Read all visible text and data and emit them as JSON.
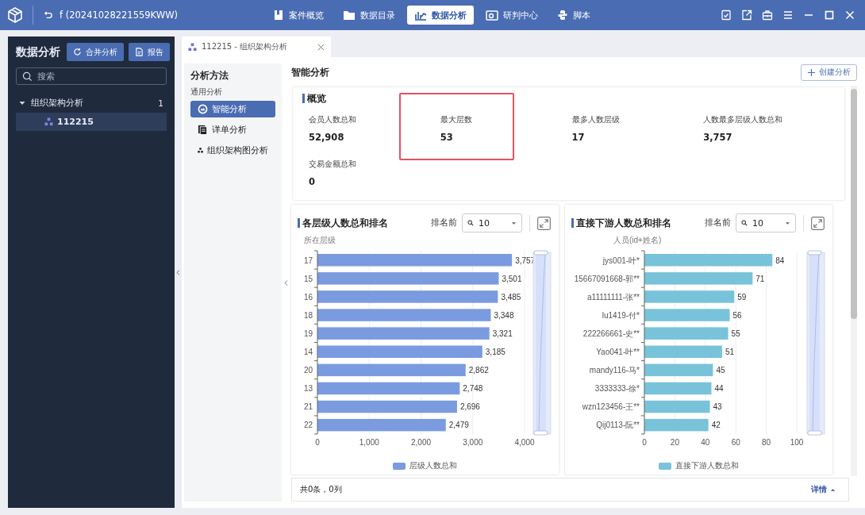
{
  "title_bar": {
    "title": "f (20241028221559KWW)",
    "nav": [
      {
        "label": "案件概览",
        "selected": false
      },
      {
        "label": "数据目录",
        "selected": false
      },
      {
        "label": "数据分析",
        "selected": true
      },
      {
        "label": "研判中心",
        "selected": false
      },
      {
        "label": "脚本",
        "selected": false
      }
    ]
  },
  "sidebar": {
    "title": "数据分析",
    "buttons": [
      "合并分析",
      "报告"
    ],
    "search": {
      "placeholder": "搜索"
    },
    "tree": [
      {
        "label": "组织架构分析",
        "count": "1",
        "expanded": true,
        "selected": false,
        "children": [
          {
            "label": "112215",
            "selected": true
          }
        ]
      }
    ]
  },
  "tab": {
    "label": "112215 - 组织架构分析"
  },
  "methods": {
    "title": "分析方法",
    "group": "通用分析",
    "items": [
      {
        "label": "智能分析",
        "selected": true
      },
      {
        "label": "详单分析",
        "selected": false
      },
      {
        "label": "组织架构图分析",
        "selected": false
      }
    ]
  },
  "content": {
    "title": "智能分析",
    "create_button": "创建分析",
    "overview": {
      "title": "概览",
      "stats": [
        {
          "label": "会员人数总和",
          "value": "52,908",
          "highlighted": false
        },
        {
          "label": "最大层数",
          "value": "53",
          "highlighted": true
        },
        {
          "label": "最多人数层级",
          "value": "17",
          "highlighted": false
        },
        {
          "label": "人数最多层级人数总和",
          "value": "3,757",
          "highlighted": false
        },
        {
          "label": "交易金额总和",
          "value": "0",
          "highlighted": false
        }
      ]
    },
    "charts": [
      {
        "title": "各层级人数总和排名",
        "rank_label": "排名前",
        "rank_value": "10",
        "chart_data": {
          "type": "bar",
          "orientation": "horizontal",
          "ylabel": "所在层级",
          "categories": [
            "17",
            "15",
            "16",
            "18",
            "19",
            "14",
            "20",
            "13",
            "21",
            "22"
          ],
          "series": [
            {
              "name": "层级人数总和",
              "color": "#7b9be0",
              "values": [
                3757,
                3501,
                3485,
                3348,
                3321,
                3185,
                2862,
                2748,
                2696,
                2479
              ]
            }
          ],
          "xlim": [
            0,
            4000
          ],
          "xticks": [
            {
              "value": 0,
              "label": "0"
            },
            {
              "value": 1000,
              "label": "1,000"
            },
            {
              "value": 2000,
              "label": "2,000"
            },
            {
              "value": 3000,
              "label": "3,000"
            },
            {
              "value": 4000,
              "label": "4,000"
            }
          ],
          "grid": true,
          "value_labels": [
            "3,757",
            "3,501",
            "3,485",
            "3,348",
            "3,321",
            "3,185",
            "2,862",
            "2,748",
            "2,696",
            "2,479"
          ]
        }
      },
      {
        "title": "直接下游人数总和排名",
        "rank_label": "排名前",
        "rank_value": "10",
        "chart_data": {
          "type": "bar",
          "orientation": "horizontal",
          "ylabel": "人员(id+姓名)",
          "categories": [
            "jys001-叶*",
            "15667091668-郭**",
            "a11111111-张**",
            "lu1419-付*",
            "222266661-史**",
            "Yao041-叶**",
            "mandy116-马*",
            "3333333-徐*",
            "wzn123456-王**",
            "Qij0113-阮**"
          ],
          "series": [
            {
              "name": "直接下游人数总和",
              "color": "#78c3da",
              "values": [
                84,
                71,
                59,
                56,
                55,
                51,
                45,
                44,
                43,
                42
              ]
            }
          ],
          "xlim": [
            0,
            100
          ],
          "xticks": [
            0,
            20,
            40,
            60,
            80,
            100
          ],
          "grid": true,
          "value_labels": [
            "84",
            "71",
            "59",
            "56",
            "55",
            "51",
            "45",
            "44",
            "43",
            "42"
          ]
        }
      }
    ],
    "footer": {
      "summary": "共0条，0列",
      "details": "详情"
    }
  }
}
